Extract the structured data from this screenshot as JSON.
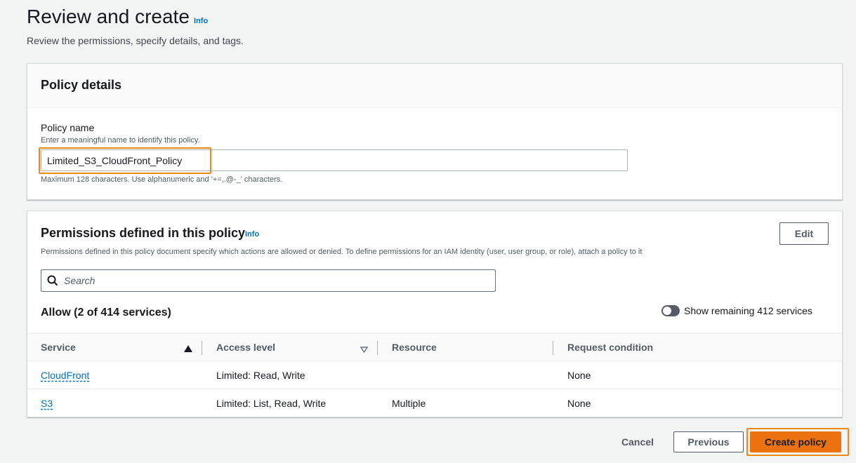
{
  "header": {
    "title": "Review and create",
    "info": "Info",
    "description": "Review the permissions, specify details, and tags."
  },
  "policy_details": {
    "title": "Policy details",
    "name_label": "Policy name",
    "name_description": "Enter a meaningful name to identify this policy.",
    "name_value": "Limited_S3_CloudFront_Policy",
    "name_constraint": "Maximum 128 characters. Use alphanumeric and '+=,.@-_' characters."
  },
  "permissions": {
    "title": "Permissions defined in this policy",
    "info": "Info",
    "edit_label": "Edit",
    "description": "Permissions defined in this policy document specify which actions are allowed or denied. To define permissions for an IAM identity (user, user group, or role), attach a policy to it",
    "search_placeholder": "Search",
    "allow_heading": "Allow (2 of 414 services)",
    "toggle_label": "Show remaining 412 services",
    "columns": [
      "Service",
      "Access level",
      "Resource",
      "Request condition"
    ],
    "rows": [
      {
        "service": "CloudFront",
        "access_level": "Limited: Read, Write",
        "resource": "",
        "request_condition": "None"
      },
      {
        "service": "S3",
        "access_level": "Limited: List, Read, Write",
        "resource": "Multiple",
        "request_condition": "None"
      }
    ]
  },
  "footer": {
    "cancel_label": "Cancel",
    "previous_label": "Previous",
    "create_label": "Create policy"
  },
  "colors": {
    "accent": "#ec7211",
    "highlight": "#ec8a18",
    "link": "#0073bb"
  }
}
